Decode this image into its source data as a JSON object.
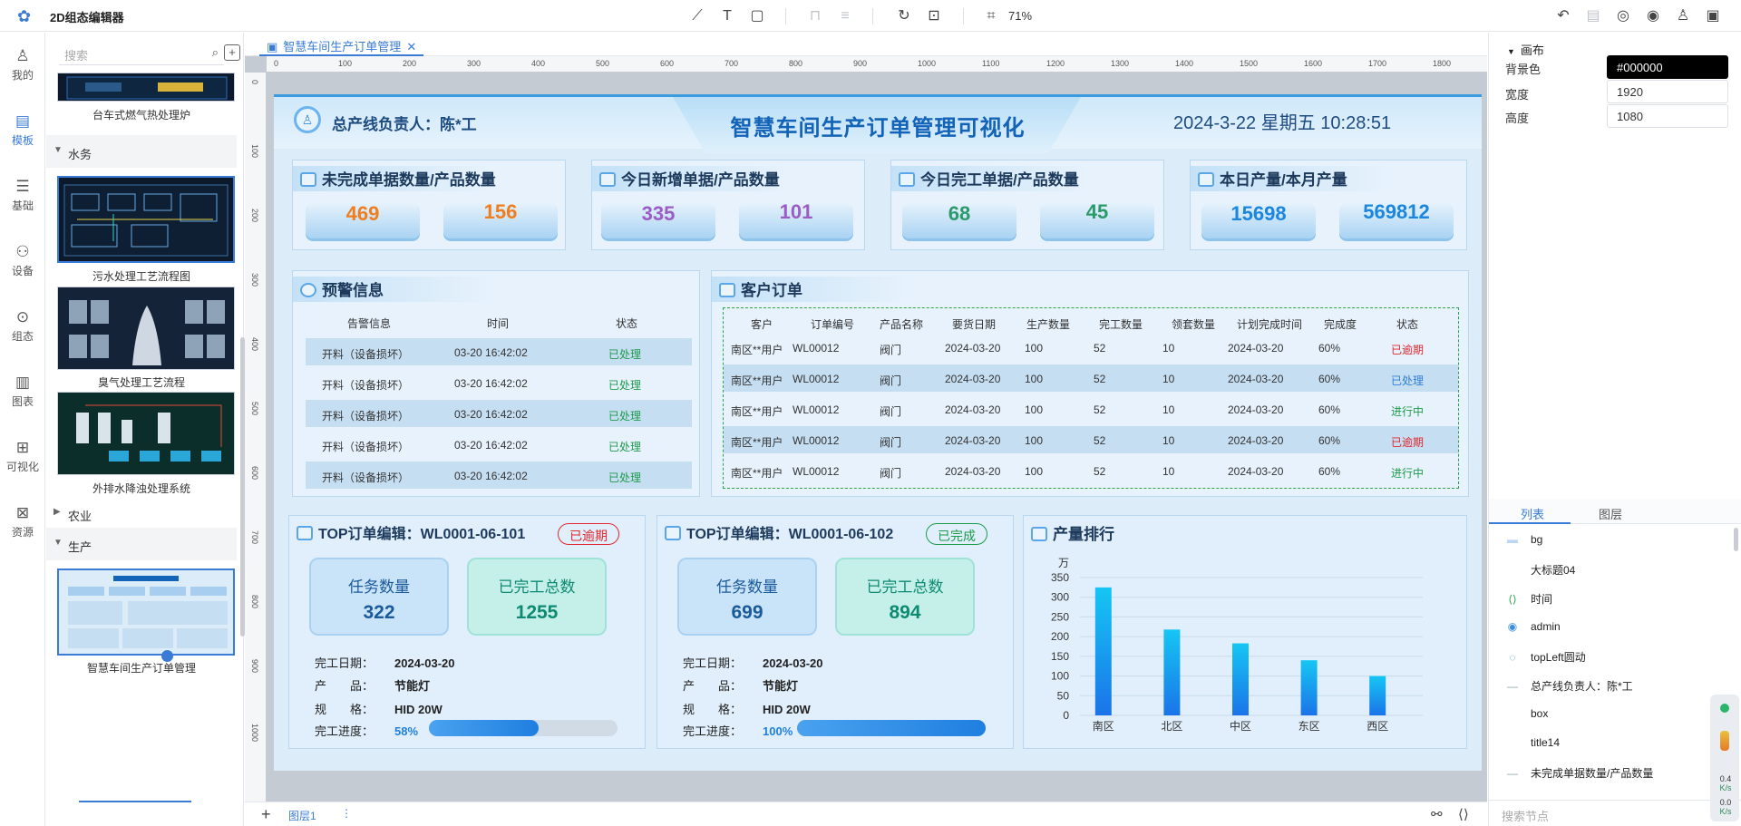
{
  "app": {
    "title": "2D组态编辑器"
  },
  "toolbar": {
    "zoom": "71%"
  },
  "rail": [
    {
      "label": "我的",
      "icon": "user-icon"
    },
    {
      "label": "模板",
      "icon": "template-icon"
    },
    {
      "label": "基础",
      "icon": "basic-icon"
    },
    {
      "label": "设备",
      "icon": "device-icon"
    },
    {
      "label": "组态",
      "icon": "config-icon"
    },
    {
      "label": "图表",
      "icon": "chart-icon"
    },
    {
      "label": "可视化",
      "icon": "visual-icon"
    },
    {
      "label": "资源",
      "icon": "resource-icon"
    }
  ],
  "left_panel": {
    "search_placeholder": "搜索",
    "captions": [
      "台车式燃气热处理炉",
      "污水处理工艺流程图",
      "臭气处理工艺流程",
      "外排水降浊处理系统",
      "智慧车间生产订单管理"
    ],
    "groups": [
      "水务",
      "农业",
      "生产"
    ]
  },
  "tab": {
    "label": "智慧车间生产订单管理"
  },
  "ruler": {
    "h": [
      "0",
      "100",
      "200",
      "300",
      "400",
      "500",
      "600",
      "700",
      "800",
      "900",
      "1000",
      "1100",
      "1200",
      "1300",
      "1400",
      "1500",
      "1600",
      "1700",
      "1800"
    ],
    "v": [
      "0",
      "100",
      "200",
      "300",
      "400",
      "500",
      "600",
      "700",
      "800",
      "900",
      "1000"
    ]
  },
  "bottom": {
    "layer": "图层1"
  },
  "dashboard": {
    "title": "智慧车间生产订单管理可视化",
    "admin": "总产线负责人：陈*工",
    "time": "2024-3-22 星期五 10:28:51",
    "kpis": [
      {
        "title": "未完成单据数量/产品数量",
        "a": "469",
        "b": "156",
        "color": "#f07d1e"
      },
      {
        "title": "今日新增单据/产品数量",
        "a": "335",
        "b": "101",
        "color": "#9b5cc6"
      },
      {
        "title": "今日完工单据/产品数量",
        "a": "68",
        "b": "45",
        "color": "#2b9a6a"
      },
      {
        "title": "本日产量/本月产量",
        "a": "15698",
        "b": "569812",
        "color": "#1a86e0"
      }
    ],
    "alerts": {
      "title": "预警信息",
      "headers": [
        "告警信息",
        "时间",
        "状态"
      ],
      "rows": [
        [
          "开料（设备损坏）",
          "03-20 16:42:02",
          "已处理"
        ],
        [
          "开料（设备损坏）",
          "03-20 16:42:02",
          "已处理"
        ],
        [
          "开料（设备损坏）",
          "03-20 16:42:02",
          "已处理"
        ],
        [
          "开料（设备损坏）",
          "03-20 16:42:02",
          "已处理"
        ],
        [
          "开料（设备损坏）",
          "03-20 16:42:02",
          "已处理"
        ]
      ]
    },
    "orders": {
      "title": "客户订单",
      "headers": [
        "客户",
        "订单编号",
        "产品名称",
        "要货日期",
        "生产数量",
        "完工数量",
        "领套数量",
        "计划完成时间",
        "完成度",
        "状态"
      ],
      "rows": [
        [
          "南区**用户",
          "WL00012",
          "阀门",
          "2024-03-20",
          "100",
          "52",
          "10",
          "2024-03-20",
          "60%",
          "已逾期"
        ],
        [
          "南区**用户",
          "WL00012",
          "阀门",
          "2024-03-20",
          "100",
          "52",
          "10",
          "2024-03-20",
          "60%",
          "已处理"
        ],
        [
          "南区**用户",
          "WL00012",
          "阀门",
          "2024-03-20",
          "100",
          "52",
          "10",
          "2024-03-20",
          "60%",
          "进行中"
        ],
        [
          "南区**用户",
          "WL00012",
          "阀门",
          "2024-03-20",
          "100",
          "52",
          "10",
          "2024-03-20",
          "60%",
          "已逾期"
        ],
        [
          "南区**用户",
          "WL00012",
          "阀门",
          "2024-03-20",
          "100",
          "52",
          "10",
          "2024-03-20",
          "60%",
          "进行中"
        ]
      ]
    },
    "top_orders": [
      {
        "title": "TOP订单编辑：WL0001-06-101",
        "badge": "已逾期",
        "badge_color": "#e0282e",
        "task_label": "任务数量",
        "task": "322",
        "done_label": "已完工总数",
        "done": "1255",
        "date_k": "完工日期：",
        "date": "2024-03-20",
        "prod_k": "产　　品：",
        "prod": "节能灯",
        "spec_k": "规　　格：",
        "spec": "HID 20W",
        "prog_k": "完工进度：",
        "prog": "58%",
        "prog_value": 58
      },
      {
        "title": "TOP订单编辑：WL0001-06-102",
        "badge": "已完成",
        "badge_color": "#1c9a4a",
        "task_label": "任务数量",
        "task": "699",
        "done_label": "已完工总数",
        "done": "894",
        "date_k": "完工日期：",
        "date": "2024-03-20",
        "prod_k": "产　　品：",
        "prod": "节能灯",
        "spec_k": "规　　格：",
        "spec": "HID 20W",
        "prog_k": "完工进度：",
        "prog": "100%",
        "prog_value": 100
      }
    ],
    "rank_title": "产量排行"
  },
  "chart_data": {
    "type": "bar",
    "title": "",
    "unit": "万",
    "categories": [
      "南区",
      "北区",
      "中区",
      "东区",
      "西区"
    ],
    "values": [
      325,
      218,
      183,
      140,
      100
    ],
    "ylim": [
      0,
      350
    ],
    "yticks": [
      "350",
      "300",
      "250",
      "200",
      "150",
      "100",
      "50",
      "0"
    ]
  },
  "right_panel": {
    "section": "画布",
    "bg_label": "背景色",
    "bg_value": "#000000",
    "w_label": "宽度",
    "w_value": "1920",
    "h_label": "高度",
    "h_value": "1080",
    "tabs": [
      "列表",
      "图层"
    ],
    "nodes": [
      "bg",
      "大标题04",
      "时间",
      "admin",
      "topLeft圆动",
      "总产线负责人：陈*工",
      "box",
      "title14",
      "未完成单据数量/产品数量"
    ],
    "search_placeholder": "搜索节点"
  },
  "widget": {
    "a": "0.4",
    "b": "0.0",
    "unit": "K/s"
  }
}
